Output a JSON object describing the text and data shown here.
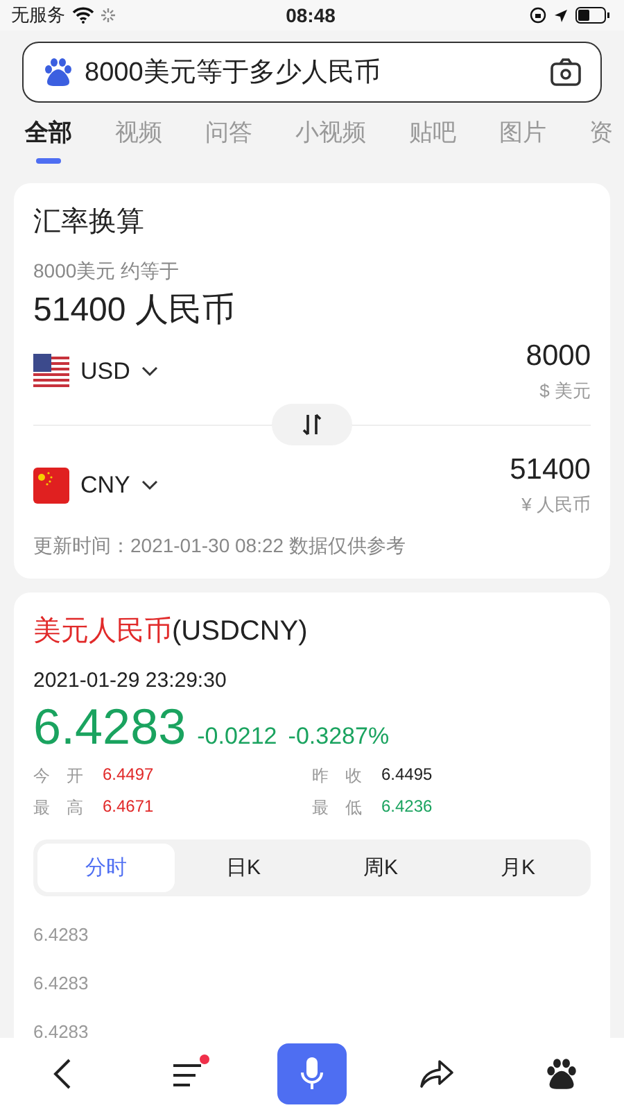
{
  "status_bar": {
    "carrier": "无服务",
    "time": "08:48"
  },
  "search": {
    "value": "8000美元等于多少人民币"
  },
  "tabs": [
    {
      "label": "全部",
      "selected": true
    },
    {
      "label": "视频",
      "selected": false
    },
    {
      "label": "问答",
      "selected": false
    },
    {
      "label": "小视频",
      "selected": false
    },
    {
      "label": "贴吧",
      "selected": false
    },
    {
      "label": "图片",
      "selected": false
    },
    {
      "label": "资",
      "selected": false
    }
  ],
  "converter": {
    "title": "汇率换算",
    "subtitle": "8000美元 约等于",
    "result": "51400 人民币",
    "currencies": [
      {
        "kind": "us",
        "code": "USD",
        "amount": "8000",
        "unit": "$ 美元"
      },
      {
        "kind": "cn",
        "code": "CNY",
        "amount": "51400",
        "unit": "¥ 人民币"
      }
    ],
    "footnote": "更新时间：2021-01-30 08:22 数据仅供参考"
  },
  "quote": {
    "title_name": "美元人民币",
    "title_code": "(USDCNY)",
    "datetime": "2021-01-29 23:29:30",
    "price": "6.4283",
    "change": "-0.0212",
    "change_pct": "-0.3287%",
    "stats": [
      {
        "label": "今　开",
        "value": "6.4497",
        "color": "#e12a2a"
      },
      {
        "label": "昨　收",
        "value": "6.4495",
        "color": "#222222"
      },
      {
        "label": "最　高",
        "value": "6.4671",
        "color": "#e12a2a"
      },
      {
        "label": "最　低",
        "value": "6.4236",
        "color": "#1aa35f"
      }
    ],
    "periods": [
      {
        "label": "分时",
        "selected": true
      },
      {
        "label": "日K",
        "selected": false
      },
      {
        "label": "周K",
        "selected": false
      },
      {
        "label": "月K",
        "selected": false
      }
    ],
    "axis_labels": [
      "6.4283",
      "6.4283",
      "6.4283"
    ]
  },
  "bottom_nav": [
    {
      "kind": "back",
      "badge": false
    },
    {
      "kind": "menu",
      "badge": true
    },
    {
      "kind": "voice",
      "badge": false
    },
    {
      "kind": "share",
      "badge": false
    },
    {
      "kind": "home",
      "badge": false
    }
  ]
}
